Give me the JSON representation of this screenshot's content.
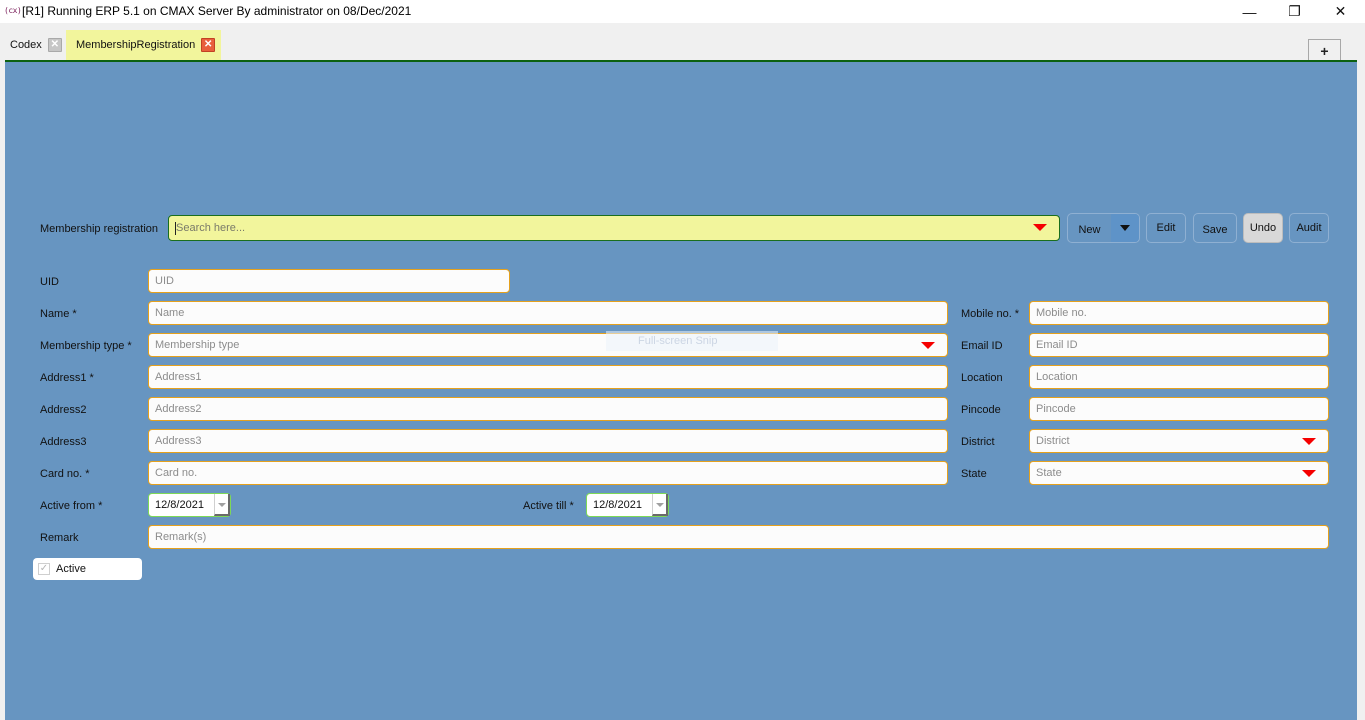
{
  "window": {
    "app_icon": "(cx)",
    "title": "[R1] Running ERP 5.1 on CMAX Server By administrator on 08/Dec/2021",
    "controls": {
      "minimize": "—",
      "restore": "❐",
      "close": "✕"
    }
  },
  "tabs": [
    {
      "label": "Codex",
      "close_icon": "close-icon",
      "active": false
    },
    {
      "label": "MembershipRegistration",
      "close_icon": "close-icon",
      "active": true
    }
  ],
  "new_tab_label": "+",
  "toolbar": {
    "search_label": "Membership registration",
    "search_placeholder": "Search here...",
    "new_label": "New",
    "edit_label": "Edit",
    "save_label": "Save",
    "undo_label": "Undo",
    "audit_label": "Audit"
  },
  "form": {
    "uid": {
      "label": "UID",
      "placeholder": "UID"
    },
    "name": {
      "label": "Name  *",
      "placeholder": "Name"
    },
    "membership_type": {
      "label": "Membership type  *",
      "placeholder": "Membership type"
    },
    "address1": {
      "label": "Address1  *",
      "placeholder": "Address1"
    },
    "address2": {
      "label": "Address2",
      "placeholder": "Address2"
    },
    "address3": {
      "label": "Address3",
      "placeholder": "Address3"
    },
    "card_no": {
      "label": "Card no. *",
      "placeholder": "Card no."
    },
    "active_from": {
      "label": "Active from *",
      "value": "12/8/2021"
    },
    "active_till": {
      "label": "Active till *",
      "value": "12/8/2021"
    },
    "remark": {
      "label": "Remark",
      "placeholder": "Remark(s)"
    },
    "mobile_no": {
      "label": "Mobile no. *",
      "placeholder": "Mobile no."
    },
    "email_id": {
      "label": "Email ID",
      "placeholder": "Email ID"
    },
    "location": {
      "label": "Location",
      "placeholder": "Location"
    },
    "pincode": {
      "label": "Pincode",
      "placeholder": "Pincode"
    },
    "district": {
      "label": "District",
      "placeholder": "District"
    },
    "state": {
      "label": "State",
      "placeholder": "State"
    },
    "active_checkbox": {
      "label": "Active",
      "checked": true
    }
  },
  "overlay": {
    "snip_label": "Full-screen Snip"
  },
  "colors": {
    "content_bg": "#6795c1",
    "accent_green": "#0c6110",
    "active_tab_bg": "#f2f59c",
    "field_border": "#e5a11d",
    "dropdown_caret": "#f50000"
  }
}
